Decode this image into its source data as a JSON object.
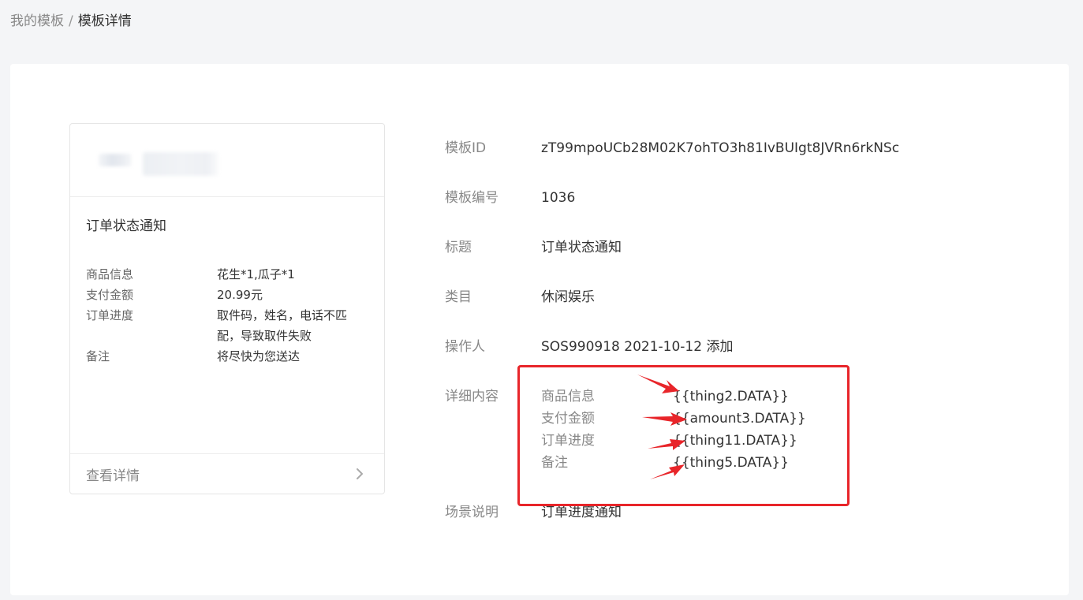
{
  "breadcrumb": {
    "parent": "我的模板",
    "separator": "/",
    "current": "模板详情"
  },
  "preview": {
    "title": "订单状态通知",
    "rows": [
      {
        "label": "商品信息",
        "value": "花生*1,瓜子*1"
      },
      {
        "label": "支付金额",
        "value": "20.99元"
      },
      {
        "label": "订单进度",
        "value": "取件码，姓名，电话不匹配，导致取件失败"
      },
      {
        "label": "备注",
        "value": "将尽快为您送达"
      }
    ],
    "footer_label": "查看详情"
  },
  "details": {
    "template_id_label": "模板ID",
    "template_id": "zT99mpoUCb28M02K7ohTO3h81IvBUIgt8JVRn6rkNSc",
    "template_no_label": "模板编号",
    "template_no": "1036",
    "title_label": "标题",
    "title": "订单状态通知",
    "category_label": "类目",
    "category": "休闲娱乐",
    "operator_label": "操作人",
    "operator": "SOS990918 2021-10-12 添加",
    "content_label": "详细内容",
    "content_rows": [
      {
        "key": "商品信息",
        "value": "{{thing2.DATA}}"
      },
      {
        "key": "支付金额",
        "value": "{{amount3.DATA}}"
      },
      {
        "key": "订单进度",
        "value": "{{thing11.DATA}}"
      },
      {
        "key": "备注",
        "value": "{{thing5.DATA}}"
      }
    ],
    "scene_label": "场景说明",
    "scene": "订单进度通知"
  },
  "colors": {
    "annotation": "#e8252a",
    "background": "#f4f5f7"
  }
}
